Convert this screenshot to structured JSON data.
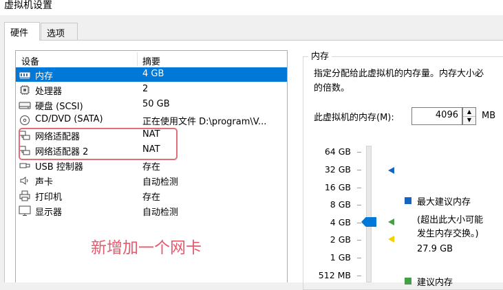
{
  "window": {
    "title": "虚拟机设置"
  },
  "tabs": [
    {
      "label": "硬件"
    },
    {
      "label": "选项"
    }
  ],
  "devices": {
    "columns": {
      "device": "设备",
      "summary": "摘要"
    },
    "rows": [
      {
        "name": "内存",
        "summary": "4 GB",
        "icon": "memory-icon",
        "selected": true
      },
      {
        "name": "处理器",
        "summary": "2",
        "icon": "cpu-icon"
      },
      {
        "name": "硬盘 (SCSI)",
        "summary": "50 GB",
        "icon": "harddisk-icon"
      },
      {
        "name": "CD/DVD (SATA)",
        "summary": "正在使用文件 D:\\program\\V...",
        "icon": "cd-icon"
      },
      {
        "name": "网络适配器",
        "summary": "NAT",
        "icon": "network-icon"
      },
      {
        "name": "网络适配器 2",
        "summary": "NAT",
        "icon": "network-icon"
      },
      {
        "name": "USB 控制器",
        "summary": "存在",
        "icon": "usb-icon"
      },
      {
        "name": "声卡",
        "summary": "自动检测",
        "icon": "speaker-icon"
      },
      {
        "name": "打印机",
        "summary": "存在",
        "icon": "printer-icon"
      },
      {
        "name": "显示器",
        "summary": "自动检测",
        "icon": "monitor-icon"
      }
    ]
  },
  "annotation": {
    "text": "新增加一个网卡",
    "color": "#e55a6c"
  },
  "memory": {
    "group_title": "内存",
    "description_line1": "指定分配给此虚拟机的内存量。内存大小必",
    "description_line2": "的倍数。",
    "field_label": "此虚拟机的内存(M):",
    "value": "4096",
    "unit": "MB",
    "scale_ticks": [
      "64 GB",
      "32 GB",
      "16 GB",
      "8 GB",
      "4 GB",
      "2 GB",
      "1 GB",
      "512 MB"
    ],
    "legend": {
      "max_label": "最大建议内存",
      "max_note_line1": "(超出此大小可能",
      "max_note_line2": "发生内存交换。)",
      "max_value": "27.9 GB",
      "recommended_label": "建议内存"
    },
    "colors": {
      "max": "#1565c0",
      "recommended": "#43a047",
      "min": "#f5d000",
      "selected": "#0078d7"
    }
  }
}
